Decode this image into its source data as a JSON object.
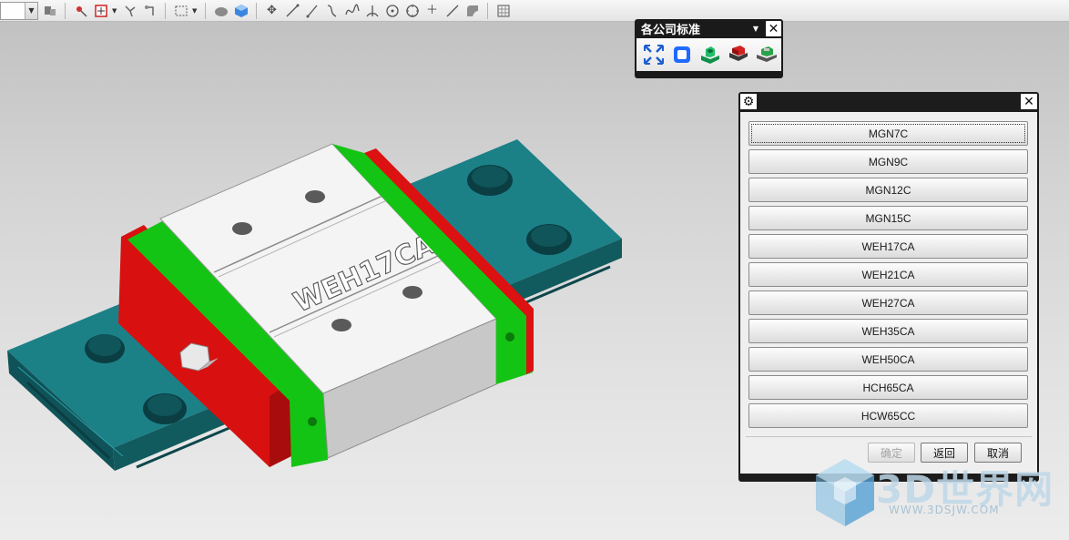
{
  "toolbar": {
    "icons": [
      "dropdown-combo",
      "part-navigator-icon",
      "snap-point-icon",
      "select-box-icon",
      "move-handle-icon",
      "rotate-handle-icon",
      "rectangle-select-icon",
      "shaded-icon",
      "cube-view-icon",
      "move-icon",
      "line-icon",
      "line-icon-2",
      "curve-icon",
      "spline-icon",
      "arc-icon",
      "circle-icon",
      "point-circle-icon",
      "plus-point-icon",
      "line-diagonal-icon",
      "fillet-icon",
      "grid-icon"
    ]
  },
  "palette": {
    "title": "各公司标准",
    "icons": [
      "fit-view-icon",
      "square-outline-icon",
      "green-block-icon",
      "red-rail-icon",
      "rail-assembly-icon"
    ]
  },
  "dialog": {
    "options": [
      "MGN7C",
      "MGN9C",
      "MGN12C",
      "MGN15C",
      "WEH17CA",
      "WEH21CA",
      "WEH27CA",
      "WEH35CA",
      "WEH50CA",
      "HCH65CA",
      "HCW65CC"
    ],
    "ok_label": "确定",
    "back_label": "返回",
    "cancel_label": "取消"
  },
  "model": {
    "block_label": "WEH17CA",
    "colors": {
      "rail": "#1c7a80",
      "rail_dark": "#115558",
      "block": "#f2f2f2",
      "seal_green": "#12c812",
      "end_red": "#e01010"
    }
  },
  "watermark": {
    "brand": "3D世界网",
    "url": "WWW.3DSJW.COM"
  }
}
